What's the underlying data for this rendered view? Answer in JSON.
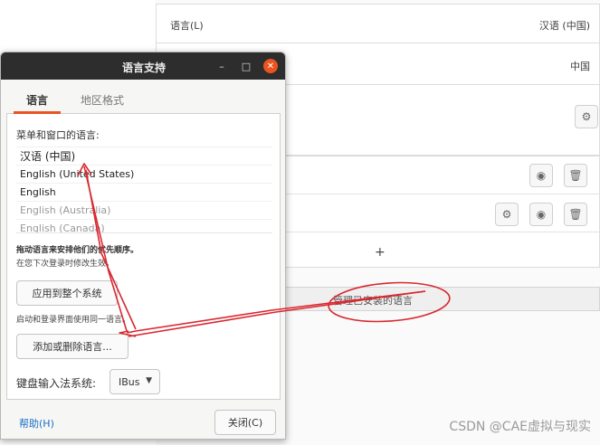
{
  "background": {
    "language_row": {
      "label": "语言(L)",
      "value": "汉语 (中国)"
    },
    "region_row": {
      "value": "中国"
    },
    "settings_icon": "gear-icon",
    "sources": [
      {
        "icons": [
          "eye-icon",
          "trash-icon"
        ]
      },
      {
        "icons": [
          "gear-icon",
          "eye-icon",
          "trash-icon"
        ]
      }
    ],
    "add_symbol": "+",
    "manage_label": "管理已安装的语言"
  },
  "dialog": {
    "title": "语言支持",
    "controls": {
      "minimize": "–",
      "maximize": "□",
      "close": "✕"
    },
    "tabs": [
      {
        "label": "语言",
        "active": true
      },
      {
        "label": "地区格式",
        "active": false
      }
    ],
    "menu_lang_label": "菜单和窗口的语言:",
    "languages": [
      {
        "name": "汉语 (中国)",
        "enabled": true
      },
      {
        "name": "English (United States)",
        "enabled": true
      },
      {
        "name": "English",
        "enabled": true
      },
      {
        "name": "English (Australia)",
        "enabled": false
      },
      {
        "name": "English (Canada)",
        "enabled": false
      }
    ],
    "drag_hint": "拖动语言来安排他们的优先顺序。",
    "effect_hint": "在您下次登录时修改生效。",
    "apply_button": "应用到整个系统",
    "login_hint": "启动和登录界面使用同一语言。",
    "add_remove_button": "添加或删除语言...",
    "keyboard_label": "键盘输入法系统:",
    "keyboard_value": "IBus",
    "help_link": "帮助(H)",
    "close_button": "关闭(C)"
  },
  "watermark": "CSDN @CAE虚拟与现实",
  "colors": {
    "accent": "#e95420",
    "annotation": "#d8282f",
    "titlebar": "#2d2d2d"
  }
}
